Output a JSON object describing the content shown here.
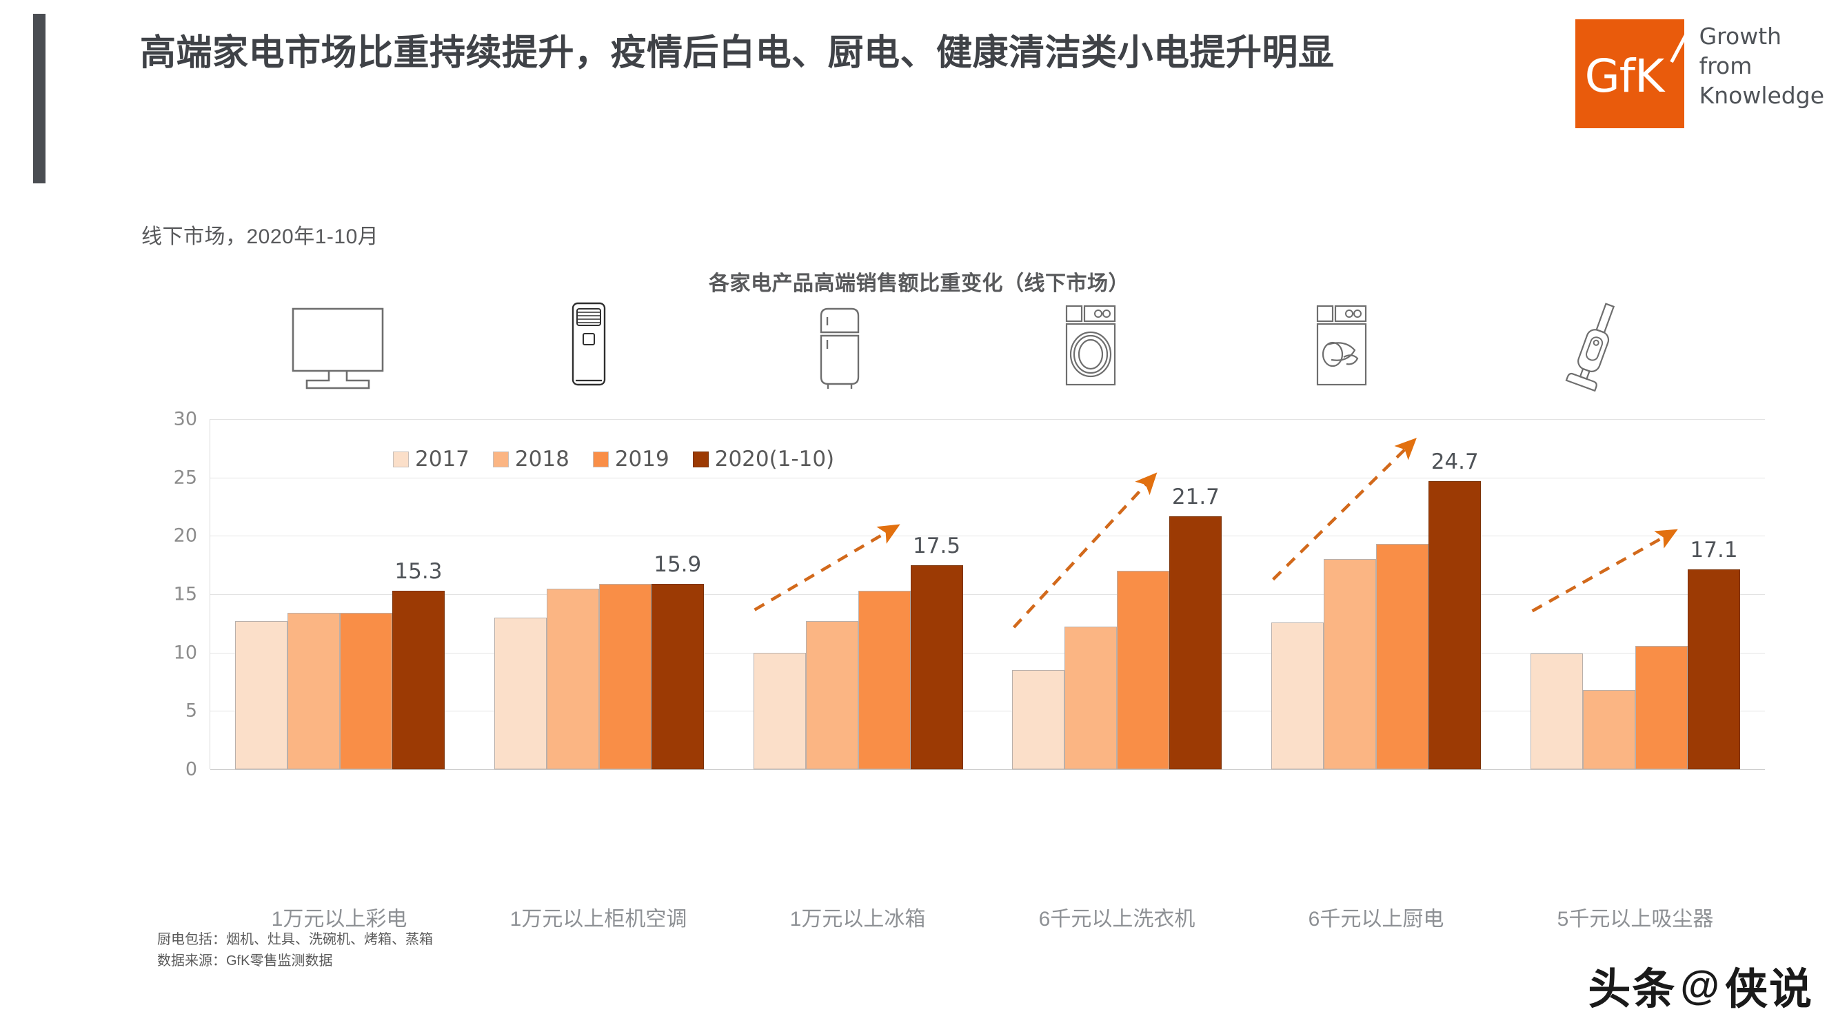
{
  "header": {
    "title": "高端家电市场比重持续提升，疫情后白电、厨电、健康清洁类小电提升明显",
    "subtitle": "线下市场，2020年1-10月"
  },
  "brand": {
    "mark_text": "GfK",
    "tagline_line1": "Growth",
    "tagline_line2": "from",
    "tagline_line3": "Knowledge",
    "mark_color": "#e95b0c"
  },
  "footnotes": {
    "line1": "厨电包括：烟机、灶具、洗碗机、烤箱、蒸箱",
    "line2": "数据来源：GfK零售监测数据"
  },
  "watermark": {
    "left": "头条",
    "at": "@",
    "right": "侠说"
  },
  "icons": [
    {
      "name": "tv-icon",
      "label": "彩电"
    },
    {
      "name": "air-conditioner-icon",
      "label": "柜机空调"
    },
    {
      "name": "refrigerator-icon",
      "label": "冰箱"
    },
    {
      "name": "washing-machine-icon",
      "label": "洗衣机"
    },
    {
      "name": "dishwasher-icon",
      "label": "厨电"
    },
    {
      "name": "vacuum-cleaner-icon",
      "label": "吸尘器"
    }
  ],
  "chart_data": {
    "type": "bar",
    "title": "各家电产品高端销售额比重变化（线下市场）",
    "xlabel": "",
    "ylabel": "",
    "ylim": [
      0,
      30
    ],
    "yticks": [
      30,
      25,
      20,
      15,
      10,
      5,
      0
    ],
    "grid": true,
    "legend_position": "top-left",
    "categories": [
      "1万元以上彩电",
      "1万元以上柜机空调",
      "1万元以上冰箱",
      "6千元以上洗衣机",
      "6千元以上厨电",
      "5千元以上吸尘器"
    ],
    "series": [
      {
        "name": "2017",
        "color": "#fbdfc9",
        "values": [
          12.7,
          13.0,
          10.0,
          8.5,
          12.6,
          9.9
        ]
      },
      {
        "name": "2018",
        "color": "#fbb583",
        "values": [
          13.4,
          15.5,
          12.7,
          12.2,
          18.0,
          6.8
        ]
      },
      {
        "name": "2019",
        "color": "#f98e47",
        "values": [
          13.4,
          15.9,
          15.3,
          17.0,
          19.3,
          10.6
        ]
      },
      {
        "name": "2020(1-10)",
        "color": "#9c3a04",
        "values": [
          15.3,
          15.9,
          17.5,
          21.7,
          24.7,
          17.1
        ]
      }
    ],
    "data_labels": [
      "15.3",
      "15.9",
      "17.5",
      "21.7",
      "24.7",
      "17.1"
    ],
    "annotations": [
      {
        "type": "trend-arrow",
        "group": "1万元以上冰箱",
        "direction": "up",
        "color": "#d2691b"
      },
      {
        "type": "trend-arrow",
        "group": "6千元以上洗衣机",
        "direction": "up",
        "color": "#d2691b"
      },
      {
        "type": "trend-arrow",
        "group": "6千元以上厨电",
        "direction": "up",
        "color": "#d2691b"
      },
      {
        "type": "trend-arrow",
        "group": "5千元以上吸尘器",
        "direction": "up",
        "color": "#d2691b"
      }
    ]
  }
}
